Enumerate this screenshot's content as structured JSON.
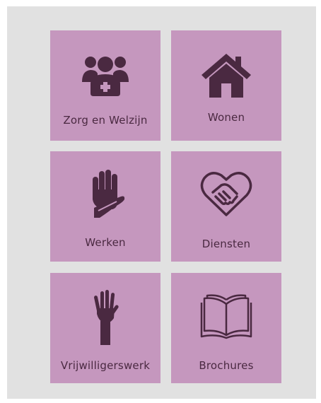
{
  "tiles": [
    {
      "label": "Zorg en Welzijn",
      "icon": "care-group-icon"
    },
    {
      "label": "Wonen",
      "icon": "house-icon"
    },
    {
      "label": "Werken",
      "icon": "helping-hands-icon"
    },
    {
      "label": "Diensten",
      "icon": "heart-handshake-icon"
    },
    {
      "label": "Vrijwilligerswerk",
      "icon": "raised-hand-icon"
    },
    {
      "label": "Brochures",
      "icon": "open-book-icon"
    }
  ],
  "colors": {
    "background_panel": "#e1e1e1",
    "tile": "#c597be",
    "icon_and_text": "#4a2941"
  }
}
